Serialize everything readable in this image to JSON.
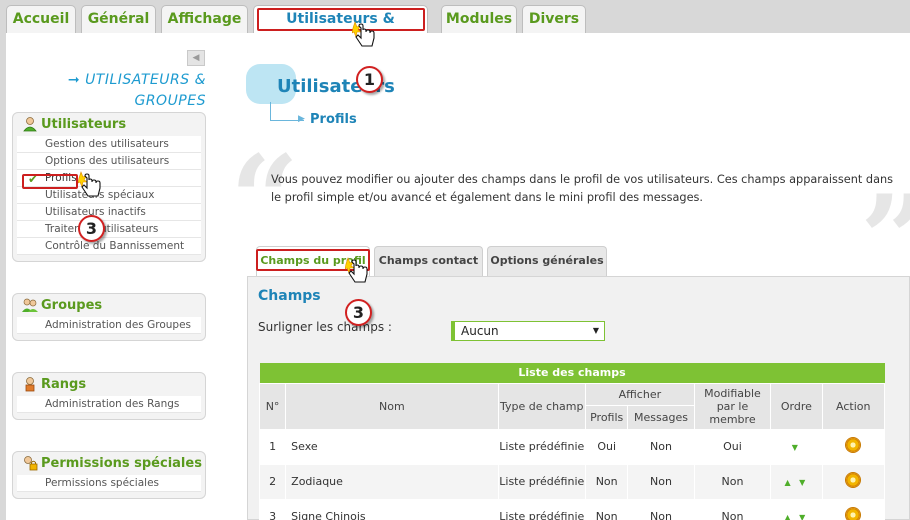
{
  "top_tabs": [
    {
      "label": "Accueil",
      "active": false
    },
    {
      "label": "Général",
      "active": false
    },
    {
      "label": "Affichage",
      "active": false
    },
    {
      "label": "Utilisateurs & Groupes",
      "active": true
    },
    {
      "label": "Modules",
      "active": false
    },
    {
      "label": "Divers",
      "active": false
    }
  ],
  "sidebar": {
    "section_title": "UTILISATEURS & GROUPES",
    "collapse_icon": "triangle-left",
    "panels": [
      {
        "title": "Utilisateurs",
        "icon": "user-icon",
        "items": [
          "Gestion des utilisateurs",
          "Options des utilisateurs",
          "Profils",
          "Utilisateurs spéciaux",
          "Utilisateurs inactifs",
          "Traiter les utilisateurs",
          "Contrôle du Bannissement"
        ]
      },
      {
        "title": "Groupes",
        "icon": "group-icon",
        "items": [
          "Administration des Groupes"
        ]
      },
      {
        "title": "Rangs",
        "icon": "rank-icon",
        "items": [
          "Administration des Rangs"
        ]
      },
      {
        "title": "Permissions spéciales",
        "icon": "lock-icon",
        "items": [
          "Permissions spéciales"
        ]
      }
    ],
    "active_item": "Profils"
  },
  "main": {
    "title": "Utilisateurs",
    "subtitle": "Profils",
    "description_line1": "Vous pouvez modifier ou ajouter des champs dans le profil de vos utilisateurs. Ces champs apparaissent dans",
    "description_line2": "le profil simple et/ou avancé et également dans le mini profil des messages.",
    "tabs": [
      {
        "label": "Champs du profil",
        "active": true
      },
      {
        "label": "Champs contact",
        "active": false
      },
      {
        "label": "Options générales",
        "active": false
      }
    ],
    "section_title": "Champs",
    "highlight_label": "Surligner les champs :",
    "highlight_value": "Aucun",
    "table": {
      "caption": "Liste des champs",
      "headers": {
        "num": "N°",
        "name": "Nom",
        "type": "Type de champ",
        "show": "Afficher",
        "show_profiles": "Profils",
        "show_messages": "Messages",
        "editable": "Modifiable par le membre",
        "order": "Ordre",
        "action": "Action"
      },
      "rows": [
        {
          "num": "1",
          "name": "Sexe",
          "type": "Liste prédéfinie",
          "profils": "Oui",
          "messages": "Non",
          "editable": "Oui",
          "order": "▼"
        },
        {
          "num": "2",
          "name": "Zodiaque",
          "type": "Liste prédéfinie",
          "profils": "Non",
          "messages": "Non",
          "editable": "Non",
          "order": "▲ ▼"
        },
        {
          "num": "3",
          "name": "Signe Chinois",
          "type": "Liste prédéfinie",
          "profils": "Non",
          "messages": "Non",
          "editable": "Non",
          "order": "▲ ▼"
        }
      ]
    }
  },
  "callouts": [
    "1",
    "3",
    "3"
  ],
  "colors": {
    "accent_green": "#7ec234",
    "accent_blue": "#1e84b7",
    "highlight_red": "#cc1f1f"
  }
}
